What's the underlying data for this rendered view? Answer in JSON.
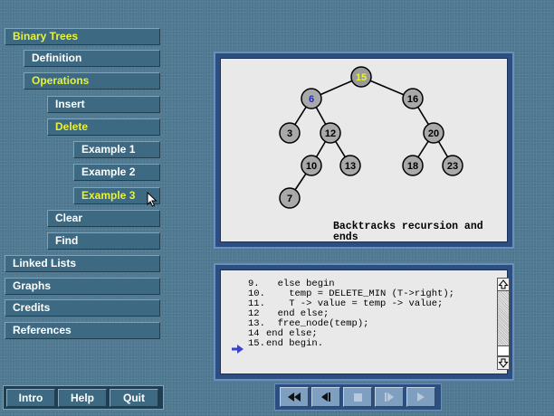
{
  "nav": {
    "binary_trees": "Binary Trees",
    "definition": "Definition",
    "operations": "Operations",
    "insert": "Insert",
    "delete": "Delete",
    "example1": "Example 1",
    "example2": "Example 2",
    "example3": "Example 3",
    "clear": "Clear",
    "find": "Find",
    "linked_lists": "Linked Lists",
    "graphs": "Graphs",
    "credits": "Credits",
    "references": "References"
  },
  "bottom_buttons": {
    "intro": "Intro",
    "help": "Help",
    "quit": "Quit"
  },
  "tree": {
    "nodes": [
      {
        "id": "n15",
        "label": "15",
        "highlight": "yellow"
      },
      {
        "id": "n6",
        "label": "6",
        "highlight": "blue-text"
      },
      {
        "id": "n16",
        "label": "16"
      },
      {
        "id": "n3",
        "label": "3"
      },
      {
        "id": "n12",
        "label": "12"
      },
      {
        "id": "n20",
        "label": "20"
      },
      {
        "id": "n10",
        "label": "10"
      },
      {
        "id": "n13",
        "label": "13"
      },
      {
        "id": "n18",
        "label": "18"
      },
      {
        "id": "n23",
        "label": "23"
      },
      {
        "id": "n7",
        "label": "7"
      }
    ],
    "message_line1": "Backtracks recursion and",
    "message_line2": "ends"
  },
  "code": {
    "lines": [
      {
        "num": "9.",
        "text": "  else begin"
      },
      {
        "num": "10.",
        "text": "    temp = DELETE_MIN (T->right);"
      },
      {
        "num": "11.",
        "text": "    T -> value = temp -> value;"
      },
      {
        "num": "12",
        "text": "  end else;"
      },
      {
        "num": "13.",
        "text": "  free_node(temp);"
      },
      {
        "num": "14",
        "text": "end else;"
      },
      {
        "num": "15.",
        "text": "end begin."
      }
    ],
    "current_line": 7
  },
  "colors": {
    "highlight_yellow": "#e8f23a",
    "current_arrow": "#3a44c8"
  },
  "icons": {
    "rewind": "rewind-icon",
    "step_back": "step-back-icon",
    "stop": "stop-icon",
    "step_forward": "step-forward-icon",
    "play": "play-icon"
  }
}
